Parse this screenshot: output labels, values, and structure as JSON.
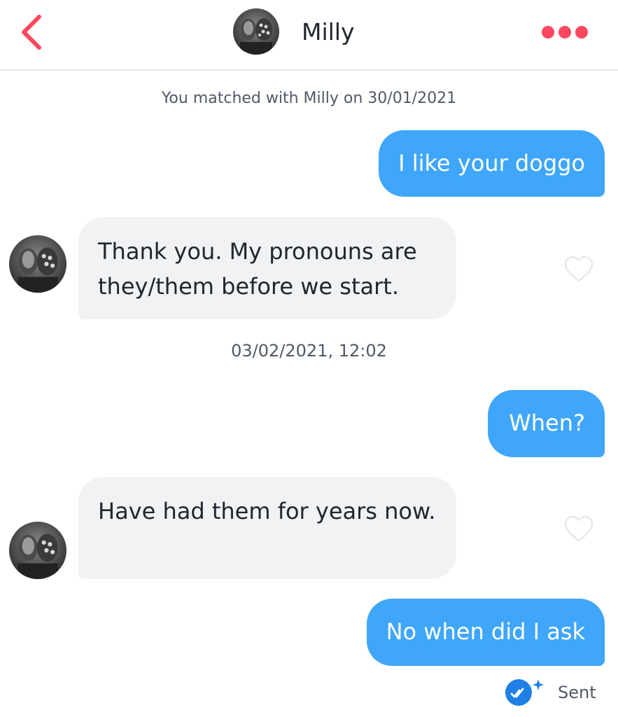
{
  "header": {
    "back_icon": "chevron-left-icon",
    "avatar_icon": "profile-photo",
    "name": "Milly",
    "more_icon": "ellipsis-icon"
  },
  "colors": {
    "accent": "#fd4760",
    "sent_bubble": "#3fa6fb",
    "received_bubble": "#f0f2f4",
    "meta_text": "#505965"
  },
  "conversation": {
    "match_note": "You matched with Milly on 30/01/2021",
    "timestamp": "03/02/2021, 12:02",
    "messages": [
      {
        "direction": "sent",
        "text": "I like your doggo"
      },
      {
        "direction": "received",
        "text": "Thank you. My pronouns are they/them before we start.",
        "like_icon": "heart-outline-icon"
      },
      {
        "direction": "sent",
        "text": "When?"
      },
      {
        "direction": "received",
        "text": "Have had them for years now.",
        "like_icon": "heart-outline-icon"
      },
      {
        "direction": "sent",
        "text": "No when did I ask"
      }
    ],
    "status": {
      "icon": "double-check-sparkle-icon",
      "text": "Sent"
    }
  }
}
